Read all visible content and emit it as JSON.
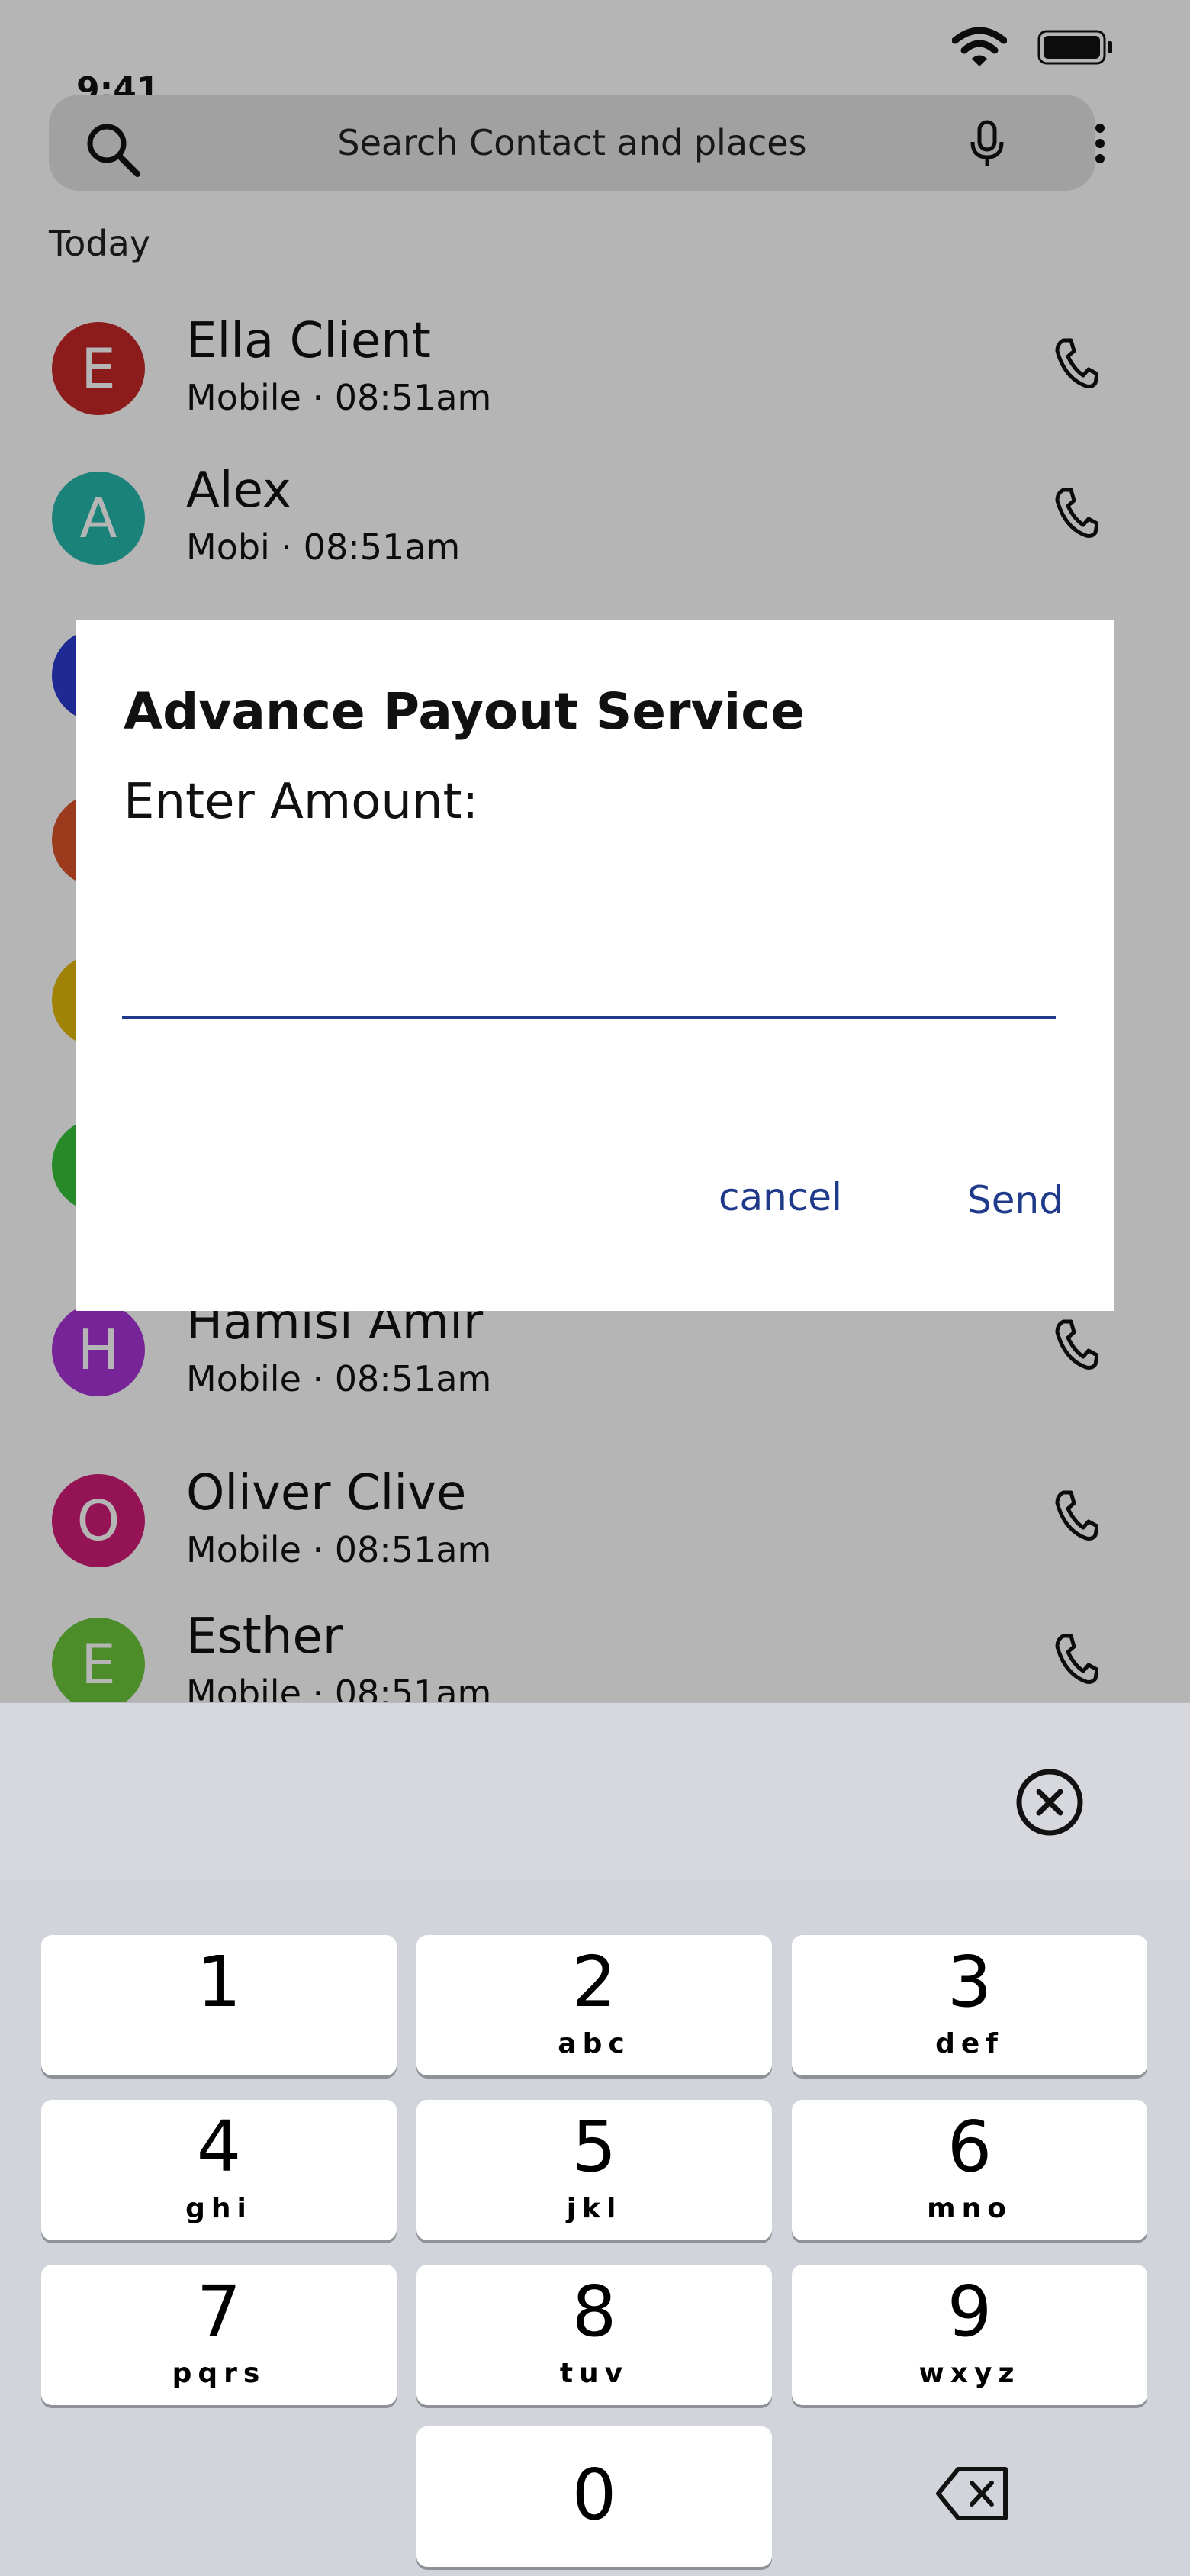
{
  "status_bar": {
    "time": "9:41"
  },
  "search": {
    "placeholder": "Search Contact and places"
  },
  "section_label": "Today",
  "contacts": [
    {
      "initial": "E",
      "name": "Ella Client",
      "subtitle": "Mobile · 08:51am",
      "color": "#c62828"
    },
    {
      "initial": "A",
      "name": "Alex",
      "subtitle": "Mobi    · 08:51am",
      "color": "#26b8ad"
    },
    {
      "initial": "",
      "name": "",
      "subtitle": "",
      "color": "#2c3ad1"
    },
    {
      "initial": "",
      "name": "",
      "subtitle": "",
      "color": "#d9542b"
    },
    {
      "initial": "",
      "name": "",
      "subtitle": "",
      "color": "#e2b80a"
    },
    {
      "initial": "",
      "name": "",
      "subtitle": "",
      "color": "#38c33a"
    },
    {
      "initial": "H",
      "name": "Hamisi Amir",
      "subtitle": "Mobile · 08:51am",
      "color": "#a833d6"
    },
    {
      "initial": "O",
      "name": "Oliver Clive",
      "subtitle": "Mobile · 08:51am",
      "color": "#d11b78"
    },
    {
      "initial": "E",
      "name": "Esther",
      "subtitle": "Mobile · 08:51am",
      "color": "#6cc53a"
    }
  ],
  "dialog": {
    "title": "Advance Payout Service",
    "label": "Enter Amount:",
    "amount_value": "",
    "cancel_label": "cancel",
    "send_label": "Send",
    "accent_color": "#1f3a8a"
  },
  "keypad": {
    "keys": [
      {
        "digit": "1",
        "letters": ""
      },
      {
        "digit": "2",
        "letters": "abc"
      },
      {
        "digit": "3",
        "letters": "def"
      },
      {
        "digit": "4",
        "letters": "ghi"
      },
      {
        "digit": "5",
        "letters": "jkl"
      },
      {
        "digit": "6",
        "letters": "mno"
      },
      {
        "digit": "7",
        "letters": "pqrs"
      },
      {
        "digit": "8",
        "letters": "tuv"
      },
      {
        "digit": "9",
        "letters": "wxyz"
      },
      {
        "digit": "0",
        "letters": ""
      }
    ],
    "clear_icon": "clear-circle-icon",
    "backspace_icon": "backspace-icon"
  }
}
